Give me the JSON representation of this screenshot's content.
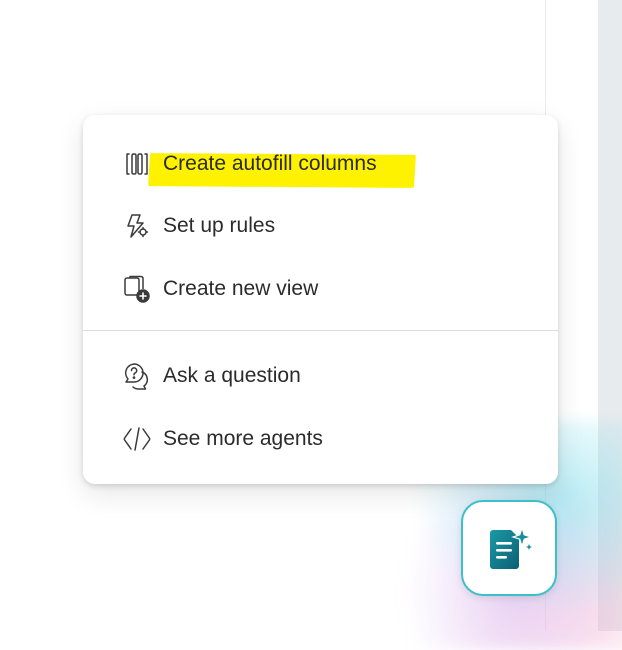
{
  "menu": {
    "items": [
      {
        "label": "Create autofill columns",
        "icon": "columns-icon",
        "highlighted": true
      },
      {
        "label": "Set up rules",
        "icon": "rule-lightning-icon"
      },
      {
        "label": "Create new view",
        "icon": "new-view-icon"
      },
      {
        "label": "Ask a question",
        "icon": "question-chat-icon"
      },
      {
        "label": "See more agents",
        "icon": "agents-code-icon"
      }
    ]
  },
  "fab": {
    "icon": "document-sparkle-icon"
  },
  "colors": {
    "highlight": "#fff200",
    "fab_border": "#3cc0c8",
    "fab_icon": "#0f7c8c",
    "text": "#2b2b2b"
  }
}
